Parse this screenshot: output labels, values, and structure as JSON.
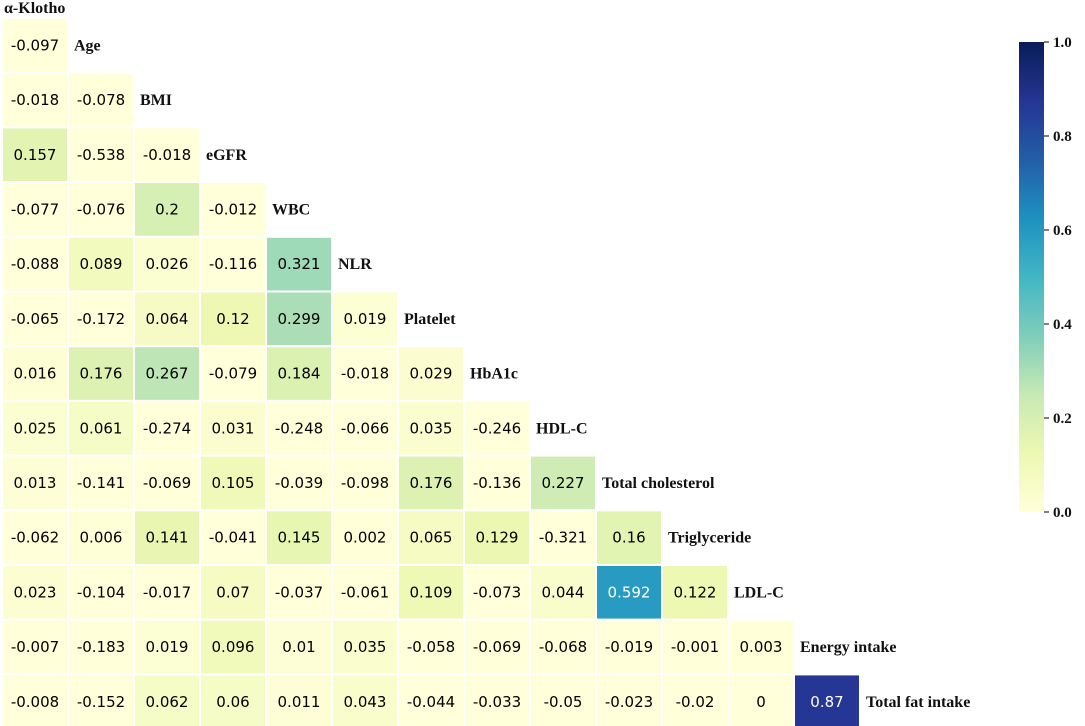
{
  "chart_data": {
    "type": "heatmap",
    "variables": [
      "α-Klotho",
      "Age",
      "BMI",
      "eGFR",
      "WBC",
      "NLR",
      "Platelet",
      "HbA1c",
      "HDL-C",
      "Total cholesterol",
      "Triglyceride",
      "LDL-C",
      "Energy intake",
      "Total fat intake"
    ],
    "rows": [
      [
        "-0.097"
      ],
      [
        "-0.018",
        "-0.078"
      ],
      [
        "0.157",
        "-0.538",
        "-0.018"
      ],
      [
        "-0.077",
        "-0.076",
        "0.2",
        "-0.012"
      ],
      [
        "-0.088",
        "0.089",
        "0.026",
        "-0.116",
        "0.321"
      ],
      [
        "-0.065",
        "-0.172",
        "0.064",
        "0.12",
        "0.299",
        "0.019"
      ],
      [
        "0.016",
        "0.176",
        "0.267",
        "-0.079",
        "0.184",
        "-0.018",
        "0.029"
      ],
      [
        "0.025",
        "0.061",
        "-0.274",
        "0.031",
        "-0.248",
        "-0.066",
        "0.035",
        "-0.246"
      ],
      [
        "0.013",
        "-0.141",
        "-0.069",
        "0.105",
        "-0.039",
        "-0.098",
        "0.176",
        "-0.136",
        "0.227"
      ],
      [
        "-0.062",
        "0.006",
        "0.141",
        "-0.041",
        "0.145",
        "0.002",
        "0.065",
        "0.129",
        "-0.321",
        "0.16"
      ],
      [
        "0.023",
        "-0.104",
        "-0.017",
        "0.07",
        "-0.037",
        "-0.061",
        "0.109",
        "-0.073",
        "0.044",
        "0.592",
        "0.122"
      ],
      [
        "-0.007",
        "-0.183",
        "0.019",
        "0.096",
        "0.01",
        "0.035",
        "-0.058",
        "-0.069",
        "-0.068",
        "-0.019",
        "-0.001",
        "0.003"
      ],
      [
        "-0.008",
        "-0.152",
        "0.062",
        "0.06",
        "0.011",
        "0.043",
        "-0.044",
        "-0.033",
        "-0.05",
        "-0.023",
        "-0.02",
        "0",
        "0.87"
      ]
    ],
    "colorbar": {
      "min": 0.0,
      "max": 1.0,
      "ticks": [
        "0.0",
        "0.2",
        "0.4",
        "0.6",
        "0.8",
        "1.0"
      ],
      "colormap": "YlGnBu"
    },
    "grid_color": "#ffffff"
  }
}
